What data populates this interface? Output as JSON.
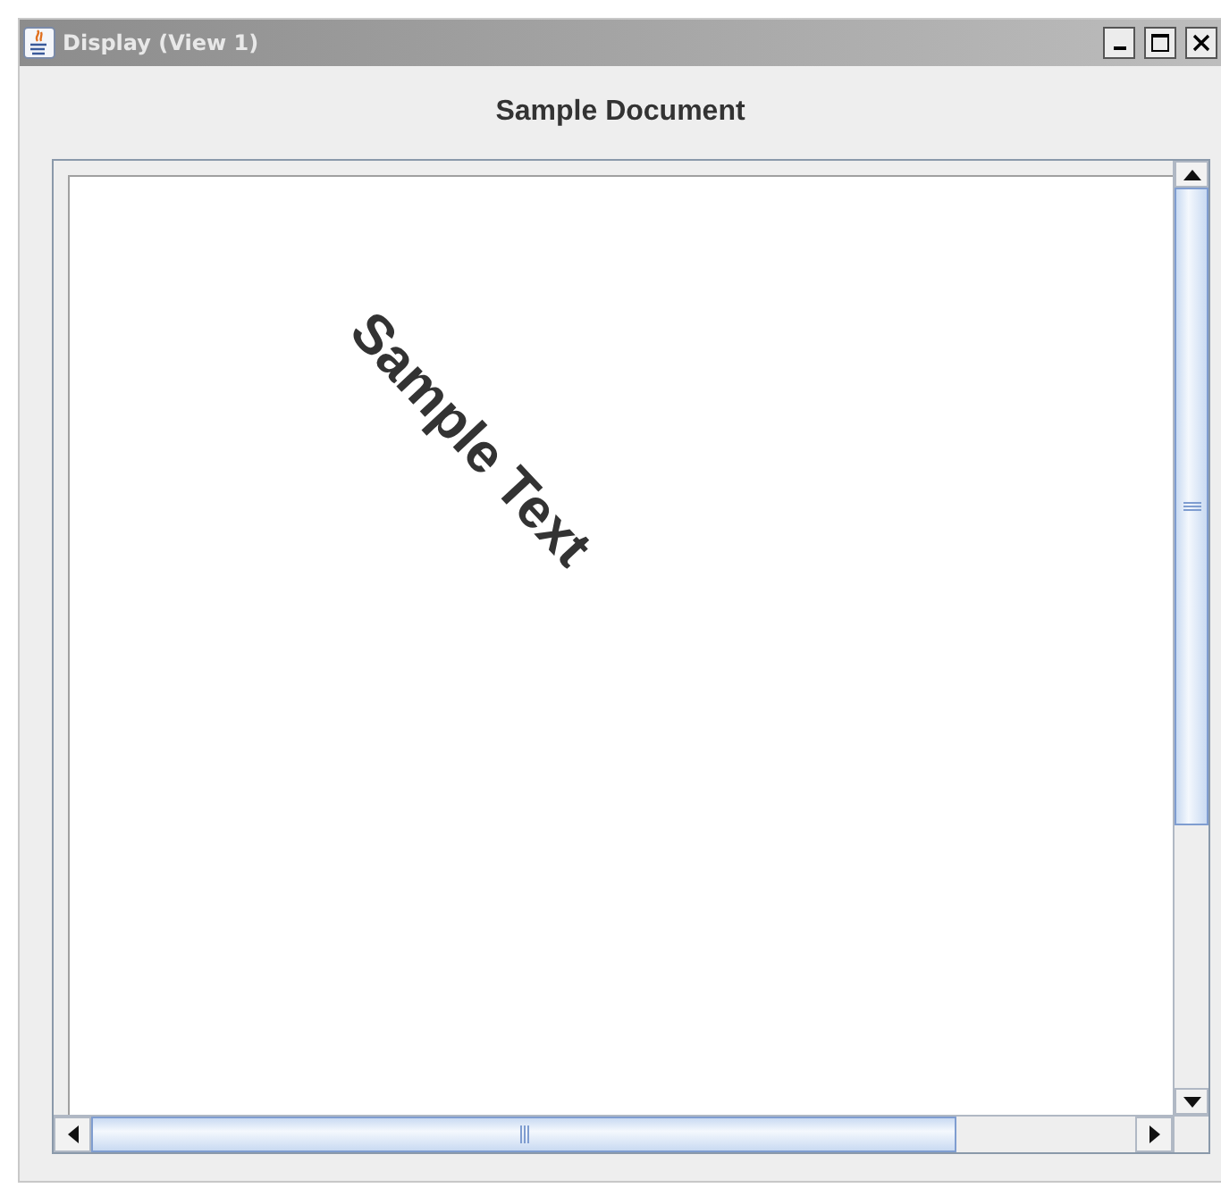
{
  "window": {
    "title": "Display (View 1)"
  },
  "document": {
    "heading": "Sample Document",
    "rotated_text": "Sample Text"
  }
}
